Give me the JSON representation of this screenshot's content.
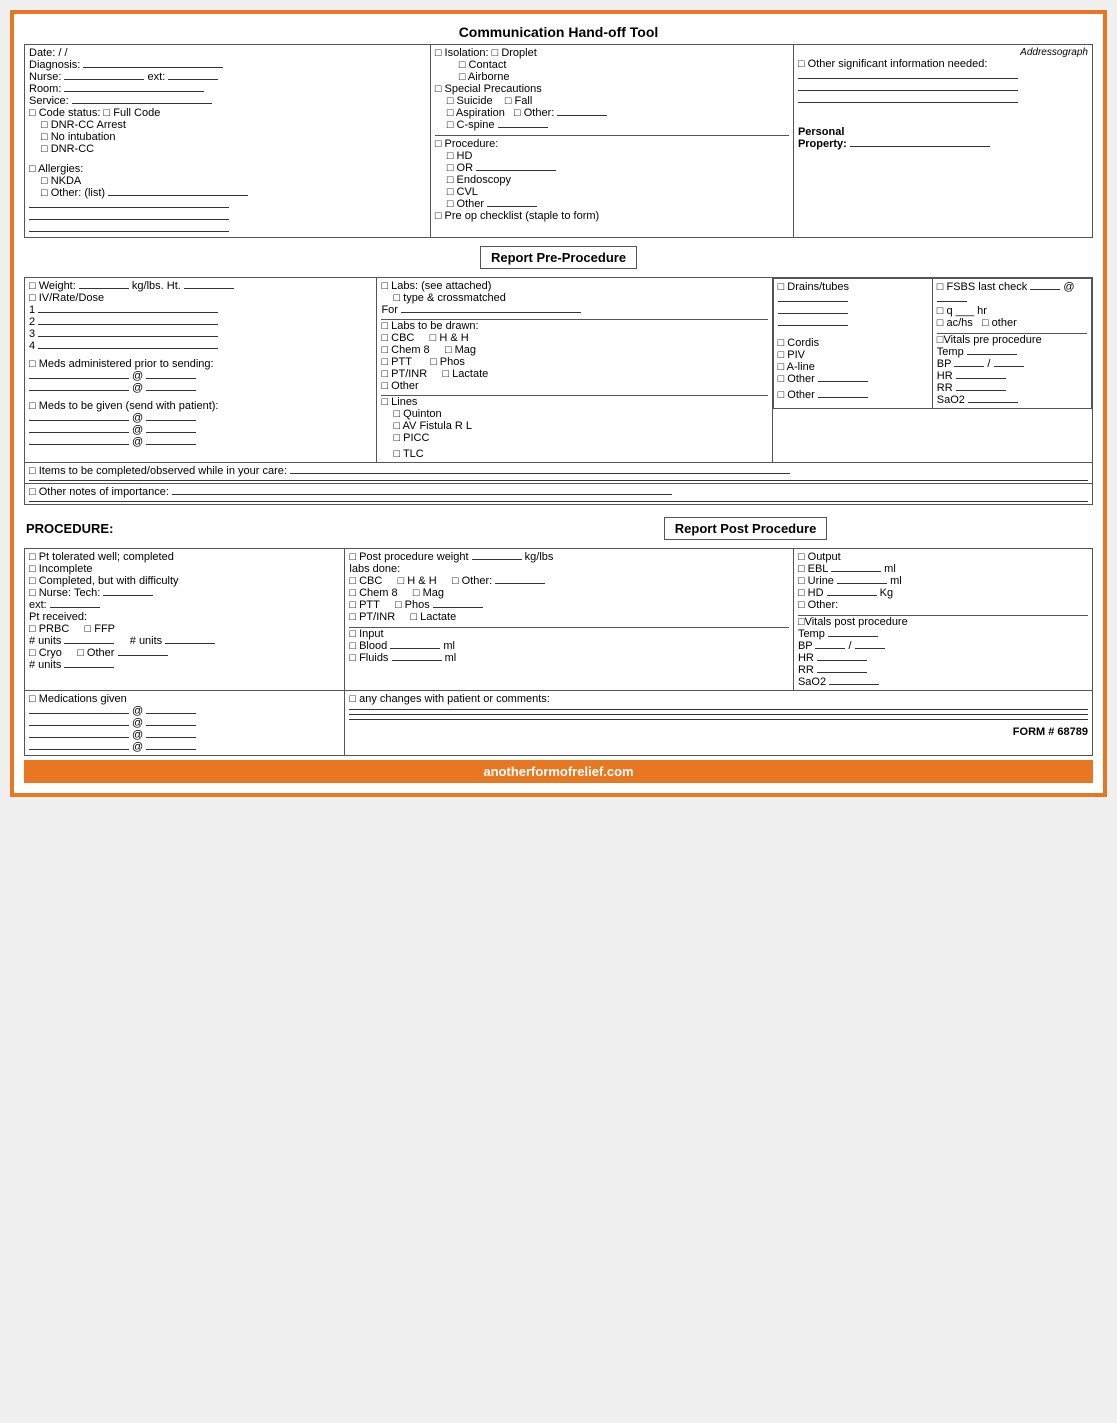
{
  "header": {
    "title": "Communication Hand-off Tool"
  },
  "top_section": {
    "date_label": "Date:",
    "date_slashes": "/ /",
    "diagnosis_label": "Diagnosis:",
    "nurse_label": "Nurse:",
    "ext_label": "ext:",
    "room_label": "Room:",
    "service_label": "Service:",
    "code_status_label": "□ Code status:",
    "full_code": "□ Full Code",
    "dnr_cc_arrest": "□ DNR-CC Arrest",
    "no_intubation": "□ No intubation",
    "dnr_cc": "□ DNR-CC",
    "allergies_label": "□ Allergies:",
    "nkda": "□ NKDA",
    "other_list": "□ Other: (list)",
    "isolation_label": "□ Isolation:",
    "droplet": "□ Droplet",
    "contact": "□ Contact",
    "airborne": "□ Airborne",
    "special_precautions": "□ Special Precautions",
    "suicide": "□ Suicide",
    "fall": "□ Fall",
    "aspiration": "□ Aspiration",
    "other_sp": "□ Other:",
    "cspine": "□ C-spine",
    "addressograph": "Addressograph",
    "procedure_label": "□ Procedure:",
    "hd": "□ HD",
    "or": "□ OR",
    "endoscopy": "□ Endoscopy",
    "cvl": "□ CVL",
    "other_proc": "□ Other",
    "pre_op": "□ Pre op checklist (staple to form)",
    "other_sig_info": "□ Other significant information needed:",
    "personal_property": "Personal Property:"
  },
  "report_pre": {
    "section_title": "Report Pre-Procedure",
    "weight_label": "□ Weight:",
    "weight_unit": "kg/lbs.  Ht.",
    "iv_rate_dose": "□ IV/Rate/Dose",
    "lines": [
      "1",
      "2",
      "3",
      "4"
    ],
    "meds_prior": "□ Meds administered prior to sending:",
    "meds_with": "□ Meds to be given (send with patient):",
    "labs_see_attached": "□ Labs: (see attached)",
    "type_crossmatched": "□ type & crossmatched",
    "for_label": "For",
    "labs_drawn_label": "□ Labs to be drawn:",
    "cbc": "□ CBC",
    "hh": "□ H & H",
    "chem8": "□ Chem 8",
    "mag": "□ Mag",
    "ptt": "□ PTT",
    "phos": "□ Phos",
    "ptinr": "□ PT/INR",
    "lactate": "□ Lactate",
    "other_labs": "□ Other",
    "drains_tubes": "□ Drains/tubes",
    "lines_label": "□ Lines",
    "quinton": "□ Quinton",
    "av_fistula": "□ AV Fistula   R   L",
    "picc": "□ PICC",
    "tlc": "□ TLC",
    "cordis": "□ Cordis",
    "piv": "□ PIV",
    "a_line": "□ A-line",
    "other_lines": "□ Other",
    "other_lines2": "□ Other",
    "fsbs": "□ FSBS last check",
    "at_symbol": "@",
    "q_hr": "□ q ___ hr",
    "achs": "□ ac/hs",
    "other_fsbs": "□ other",
    "vitals_pre": "□Vitals pre procedure",
    "temp": "Temp",
    "bp": "BP",
    "hr": "HR",
    "rr": "RR",
    "sao2": "SaO2",
    "items_completed": "□ Items to be completed/observed while in your care:",
    "other_notes": "□ Other notes of importance:"
  },
  "procedure_section": {
    "procedure_label": "PROCEDURE:",
    "report_post_title": "Report Post Procedure"
  },
  "report_post": {
    "pt_tolerated": "□ Pt tolerated well; completed",
    "incomplete": "□ Incomplete",
    "completed_difficulty": "□ Completed, but with difficulty",
    "nurse_tech": "□ Nurse: Tech:",
    "ext": "ext:",
    "pt_received": "Pt received:",
    "prbc": "□ PRBC",
    "ffp": "□ FFP",
    "units_prbc": "# units",
    "units_ffp": "# units",
    "cryo": "□ Cryo",
    "other_blood": "□ Other",
    "units_cryo": "# units",
    "post_weight": "□ Post procedure weight",
    "kg_lbs": "kg/lbs",
    "labs_done": "labs done:",
    "cbc": "□ CBC",
    "hh": "□ H & H",
    "other_labs": "□ Other:",
    "chem8": "□ Chem 8",
    "mag": "□ Mag",
    "ptt": "□ PTT",
    "phos": "□ Phos",
    "ptinr": "□ PT/INR",
    "lactate": "□ Lactate",
    "input": "□ Input",
    "blood_ml": "□ Blood",
    "fluids_ml": "□ Fluids",
    "ml1": "ml",
    "ml2": "ml",
    "output": "□ Output",
    "ebl": "□ EBL",
    "urine": "□ Urine",
    "hd": "□ HD",
    "other_out": "□ Other:",
    "ml_ebl": "ml",
    "ml_urine": "ml",
    "kg": "Kg",
    "vitals_post": "□Vitals post procedure",
    "temp": "Temp",
    "bp": "BP",
    "hr": "HR",
    "rr": "RR",
    "sao2": "SaO2",
    "meds_given": "□ Medications given",
    "any_changes": "□ any changes with patient or comments:",
    "form_number": "FORM # 68789"
  },
  "footer": {
    "website": "anotherformofrelief.com"
  }
}
